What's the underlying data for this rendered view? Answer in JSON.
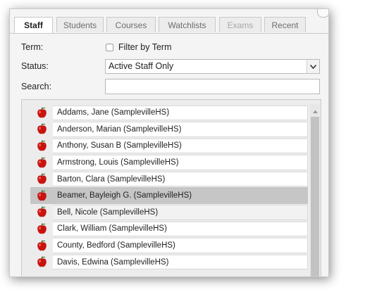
{
  "tabs": [
    {
      "label": "Staff",
      "state": "active"
    },
    {
      "label": "Students",
      "state": "normal"
    },
    {
      "label": "Courses",
      "state": "normal"
    },
    {
      "label": "Watchlists",
      "state": "normal"
    },
    {
      "label": "Exams",
      "state": "disabled"
    },
    {
      "label": "Recent",
      "state": "normal"
    }
  ],
  "form": {
    "term_label": "Term:",
    "filter_by_term_label": "Filter by Term",
    "filter_by_term_checked": false,
    "status_label": "Status:",
    "status_value": "Active Staff Only",
    "search_label": "Search:",
    "search_value": "",
    "search_placeholder": ""
  },
  "staff_list": {
    "row_icon": "apple-icon",
    "items": [
      {
        "name": "Addams, Jane (SamplevilleHS)",
        "state": "normal"
      },
      {
        "name": "Anderson, Marian (SamplevilleHS)",
        "state": "normal"
      },
      {
        "name": "Anthony, Susan B (SamplevilleHS)",
        "state": "normal"
      },
      {
        "name": "Armstrong, Louis (SamplevilleHS)",
        "state": "normal"
      },
      {
        "name": "Barton, Clara (SamplevilleHS)",
        "state": "normal"
      },
      {
        "name": "Beamer, Bayleigh G. (SamplevilleHS)",
        "state": "selected"
      },
      {
        "name": "Bell, Nicole (SamplevilleHS)",
        "state": "hover"
      },
      {
        "name": "Clark, William (SamplevilleHS)",
        "state": "normal"
      },
      {
        "name": "County, Bedford (SamplevilleHS)",
        "state": "normal"
      },
      {
        "name": "Davis, Edwina (SamplevilleHS)",
        "state": "normal"
      }
    ]
  },
  "colors": {
    "apple_red": "#c8140f",
    "selected_row": "#c6c6c6",
    "panel_bg": "#f4f4f4"
  }
}
